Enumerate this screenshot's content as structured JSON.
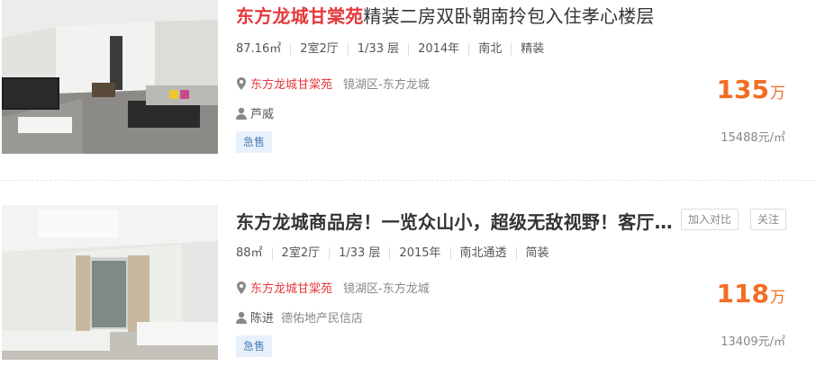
{
  "listings": [
    {
      "title_highlight": "东方龙城甘棠苑",
      "title_rest": "精装二房双卧朝南拎包入住孝心楼层",
      "attrs": [
        "87.16㎡",
        "2室2厅",
        "1/33 层",
        "2014年",
        "南北",
        "精装"
      ],
      "community": "东方龙城甘棠苑",
      "district": "镜湖区-东方龙城",
      "agent": "芦威",
      "company": "",
      "tag": "急售",
      "price": "135",
      "price_unit": "万",
      "unit_price": "15488元/㎡"
    },
    {
      "title": "东方龙城商品房！一览众山小，超级无敌视野！客厅大阳台",
      "attrs": [
        "88㎡",
        "2室2厅",
        "1/33 层",
        "2015年",
        "南北通透",
        "简装"
      ],
      "community": "东方龙城甘棠苑",
      "district": "镜湖区-东方龙城",
      "agent": "陈进",
      "company": "德佑地产民信店",
      "tag": "急售",
      "price": "118",
      "price_unit": "万",
      "unit_price": "13409元/㎡",
      "compare_label": "加入对比",
      "follow_label": "关注"
    }
  ],
  "icons": {
    "location": "map-pin-icon",
    "agent": "person-icon"
  },
  "colors": {
    "highlight": "#e4393c",
    "price": "#f26d23",
    "tag_bg": "#e8f1fb",
    "tag_text": "#4a7fb8"
  }
}
